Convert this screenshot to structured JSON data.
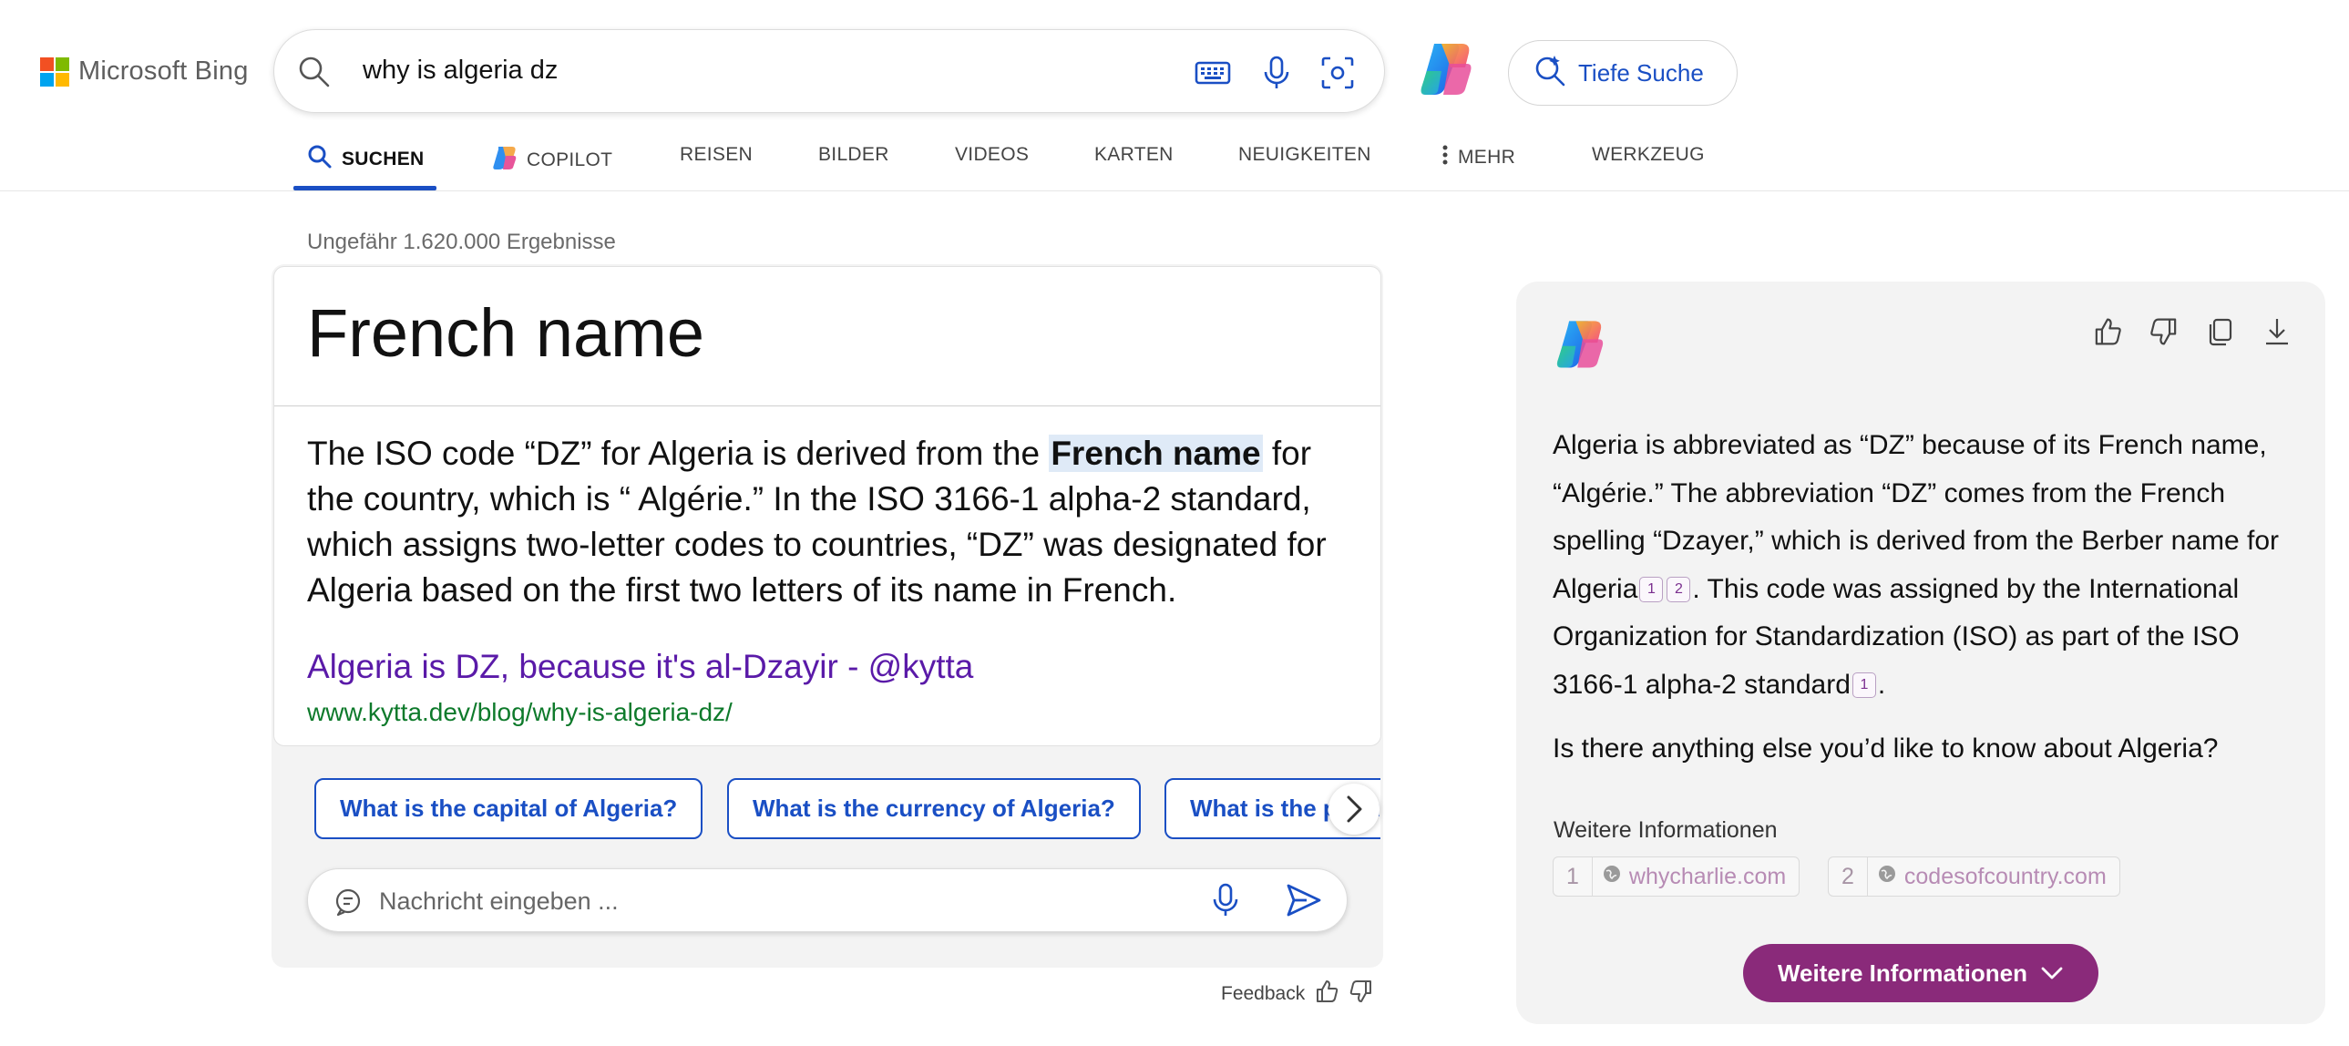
{
  "header": {
    "logo_text": "Microsoft Bing",
    "search_query": "why is algeria dz",
    "deep_search_label": "Tiefe Suche",
    "icons": [
      "search-icon",
      "keyboard-icon",
      "microphone-icon",
      "visual-search-icon",
      "copilot-icon",
      "deep-search-icon"
    ]
  },
  "nav": {
    "tabs": [
      {
        "label": "SUCHEN",
        "active": true
      },
      {
        "label": "COPILOT"
      },
      {
        "label": "REISEN"
      },
      {
        "label": "BILDER"
      },
      {
        "label": "VIDEOS"
      },
      {
        "label": "KARTEN"
      },
      {
        "label": "NEUIGKEITEN"
      },
      {
        "label": "MEHR"
      },
      {
        "label": "WERKZEUG"
      }
    ]
  },
  "results": {
    "count_text": "Ungefähr 1.620.000 Ergebnisse",
    "answer": {
      "title": "French name",
      "text_before": "The ISO code “DZ” for Algeria is derived from the ",
      "highlight": "French name",
      "text_after": " for the country, which is “ Algérie.” In the ISO 3166-1 alpha-2 standard, which assigns two-letter codes to countries, “DZ” was designated for Algeria based on the first two letters of its name in French.",
      "link_text": "Algeria is DZ, because it's al-Dzayir - @kytta",
      "url": "www.kytta.dev/blog/why-is-algeria-dz/"
    },
    "suggestions": [
      "What is the capital of Algeria?",
      "What is the currency of Algeria?",
      "What is the population of Algeria?"
    ],
    "chat_placeholder": "Nachricht eingeben ...",
    "feedback_label": "Feedback"
  },
  "copilot": {
    "text_1": "Algeria is abbreviated as “DZ” because of its French name, “Algérie.” The abbreviation “DZ” comes from the French spelling “Dzayer,” which is derived from the Berber name for Algeria",
    "cite_1": "1",
    "cite_2": "2",
    "text_2": ". This code was assigned by the International Organization for Standardization (ISO) as part of the ISO 3166-1 alpha-2 standard",
    "cite_3": "1",
    "text_3": ".",
    "question": "Is there anything else you’d like to know about Algeria?",
    "more_label": "Weitere Informationen",
    "sources": [
      {
        "num": "1",
        "domain": "whycharlie.com"
      },
      {
        "num": "2",
        "domain": "codesofcountry.com"
      }
    ],
    "more_button": "Weitere Informationen"
  },
  "colors": {
    "accent_blue": "#1a4fc4",
    "link_purple": "#5a1aa8",
    "url_green": "#0e7a2b",
    "copilot_button": "#8a2a7a"
  }
}
